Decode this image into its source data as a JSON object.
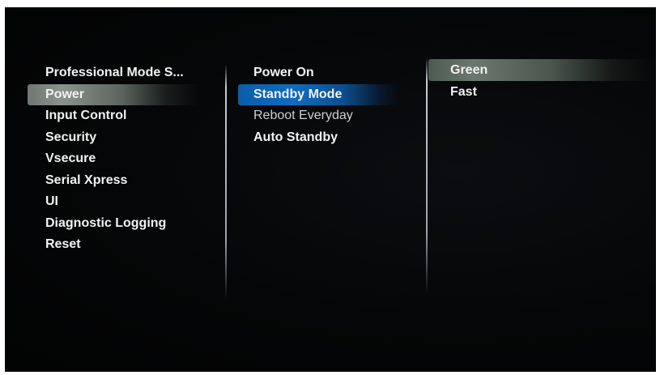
{
  "menu": {
    "categories": [
      {
        "label": "Professional Mode S..."
      },
      {
        "label": "Power"
      },
      {
        "label": "Input Control"
      },
      {
        "label": "Security"
      },
      {
        "label": "Vsecure"
      },
      {
        "label": "Serial Xpress"
      },
      {
        "label": "UI"
      },
      {
        "label": "Diagnostic Logging"
      },
      {
        "label": "Reset"
      }
    ],
    "power_options": [
      {
        "label": "Power On"
      },
      {
        "label": "Standby Mode"
      },
      {
        "label": "Reboot Everyday"
      },
      {
        "label": "Auto Standby"
      }
    ],
    "standby_values": [
      {
        "label": "Green"
      },
      {
        "label": "Fast"
      }
    ],
    "selected_category": "Power",
    "highlighted_option": "Standby Mode",
    "current_value": "Green",
    "colors": {
      "highlight_blue": "#0f6cbf",
      "highlight_grey": "#8a938d",
      "highlight_green": "#6c786f",
      "background": "#050607",
      "text": "#f2f2f2"
    }
  }
}
